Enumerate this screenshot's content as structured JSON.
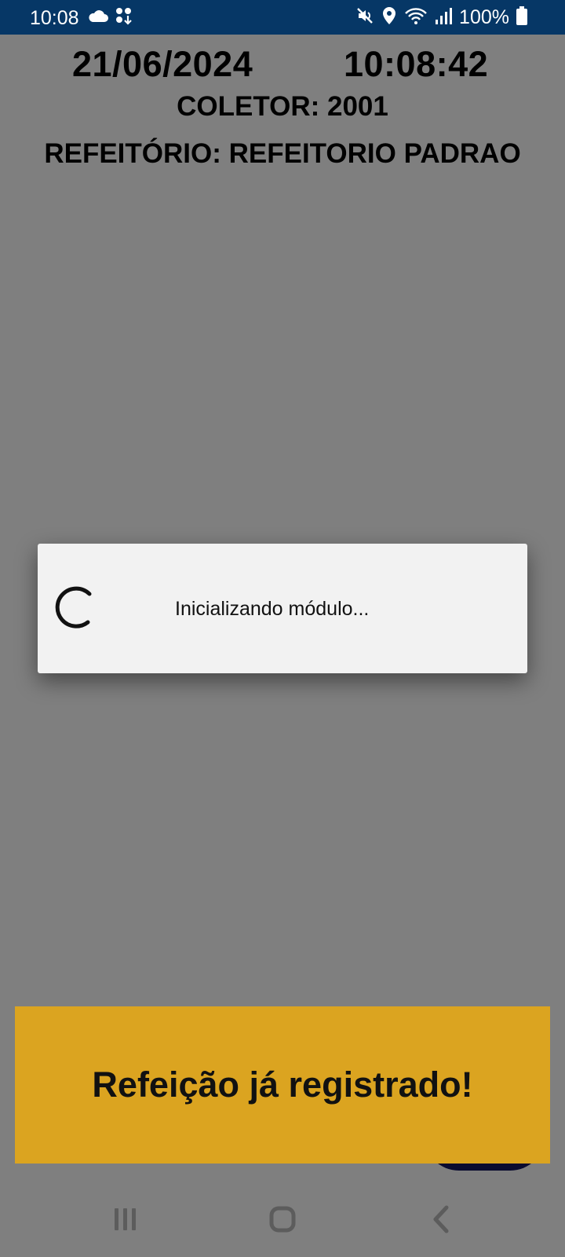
{
  "status_bar": {
    "time": "10:08",
    "battery": "100%",
    "icons_left": [
      "cloud-icon",
      "notification-dots-icon"
    ],
    "icons_right": [
      "mute-icon",
      "location-icon",
      "wifi-icon",
      "signal-icon",
      "battery-icon"
    ]
  },
  "header": {
    "date": "21/06/2024",
    "time": "10:08:42",
    "collector": "COLETOR: 2001",
    "cafeteria": "REFEITÓRIO: REFEITORIO PADRAO"
  },
  "dialog": {
    "message": "Inicializando módulo..."
  },
  "toast": {
    "message": "Refeição já registrado!"
  },
  "colors": {
    "status_bar": "#063766",
    "toast_bg": "#dba420",
    "dialog_bg": "#f2f2f2",
    "fab": "#14165e"
  },
  "nav": {
    "icons": [
      "recent-apps-icon",
      "home-icon",
      "back-icon"
    ]
  }
}
